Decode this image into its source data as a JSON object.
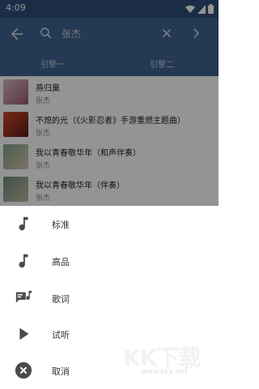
{
  "status_bar": {
    "time": "4:09"
  },
  "search": {
    "query": "张杰"
  },
  "tabs": [
    {
      "label": "引擎一"
    },
    {
      "label": "引擎二"
    }
  ],
  "songs": [
    {
      "title": "燕归巢",
      "artist": "张杰"
    },
    {
      "title": "不熄的光（《火影忍者》手游重燃主题曲）",
      "artist": "张杰"
    },
    {
      "title": "我以青春敬华年（和声伴奏）",
      "artist": "张杰"
    },
    {
      "title": "我以青春敬华年（伴奏）",
      "artist": "张杰"
    }
  ],
  "menu": {
    "items": [
      {
        "label": "标准",
        "icon": "music-note-icon"
      },
      {
        "label": "高品",
        "icon": "music-note-icon"
      },
      {
        "label": "歌词",
        "icon": "lyrics-icon"
      },
      {
        "label": "试听",
        "icon": "play-icon"
      },
      {
        "label": "取消",
        "icon": "cancel-icon"
      }
    ]
  },
  "watermark": {
    "logo": "KK下载",
    "url": "www.kkx.net"
  },
  "colors": {
    "app_bar": "#3f628f",
    "status_bar": "#2f4f79",
    "scrim": "rgba(0,0,0,0.42)",
    "icon": "#4a4a4a"
  }
}
